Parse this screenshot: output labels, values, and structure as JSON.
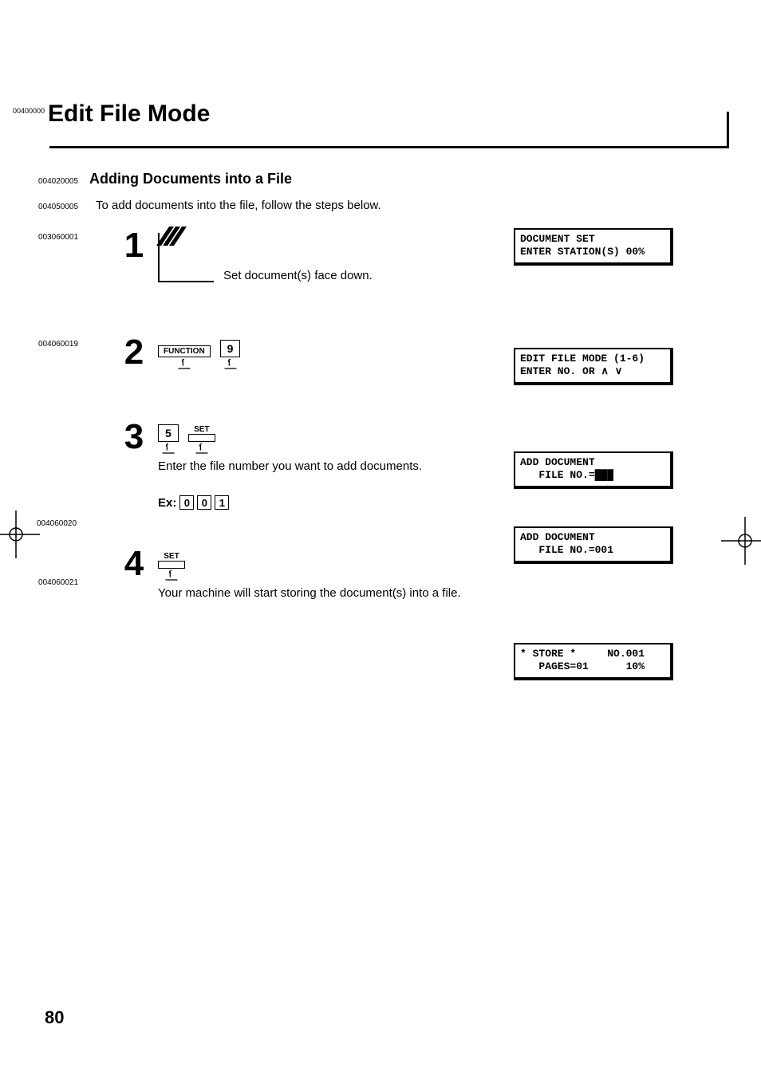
{
  "title_code": "00400000",
  "title": "Edit File Mode",
  "sub_code": "004020005",
  "subheading": "Adding Documents into a File",
  "intro_code": "004050005",
  "intro_text": "To add documents into the file, follow the steps below.",
  "steps": {
    "s1": {
      "side_code": "003060001",
      "num": "1",
      "caption": "Set document(s) face down.",
      "lcd_l1": "DOCUMENT SET",
      "lcd_l2": "ENTER STATION(S) 00%"
    },
    "s2": {
      "side_code": "004060019",
      "num": "2",
      "key1": "FUNCTION",
      "key2": "9",
      "lcd_l1": "EDIT FILE MODE (1-6)",
      "lcd_l2": "ENTER NO. OR ∧ ∨"
    },
    "s3": {
      "num": "3",
      "key1": "5",
      "key2": "SET",
      "caption": "Enter the file number you want to add documents.",
      "lcd_l1": "ADD DOCUMENT",
      "lcd_l2": "   FILE NO.=███",
      "ex_label": "Ex:",
      "ex_side_code": "004060020",
      "ex_d1": "0",
      "ex_d2": "0",
      "ex_d3": "1",
      "lcd2_l1": "ADD DOCUMENT",
      "lcd2_l2": "   FILE NO.=001"
    },
    "s4": {
      "side_code": "004060021",
      "num": "4",
      "key1": "SET",
      "caption": "Your machine will start storing the document(s) into a file.",
      "lcd_l1": "* STORE *     NO.001",
      "lcd_l2": "   PAGES=01      10%"
    }
  },
  "page_number": "80"
}
